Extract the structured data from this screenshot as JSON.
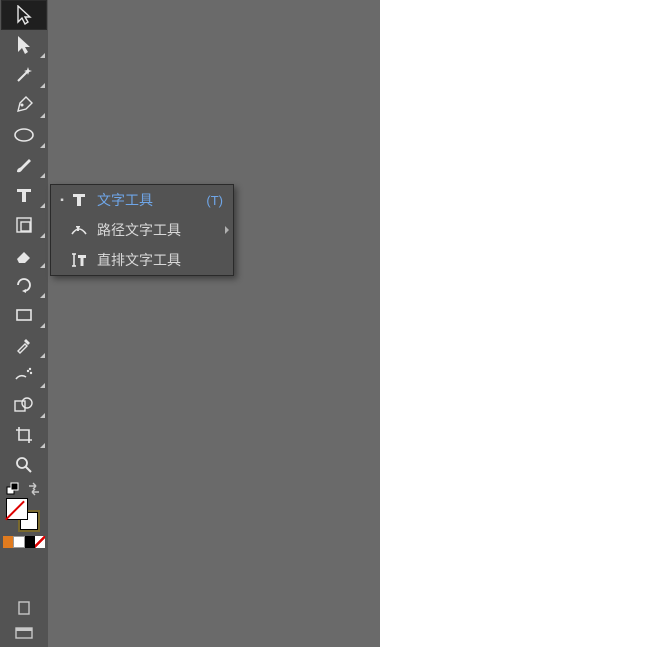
{
  "toolbar": {
    "tools": [
      {
        "name": "selection-tool",
        "selected": true,
        "flyout": false
      },
      {
        "name": "direct-selection-tool",
        "selected": false,
        "flyout": true
      },
      {
        "name": "magic-wand-tool",
        "selected": false,
        "flyout": true
      },
      {
        "name": "pen-tool",
        "selected": false,
        "flyout": true
      },
      {
        "name": "ellipse-tool",
        "selected": false,
        "flyout": true
      },
      {
        "name": "paintbrush-tool",
        "selected": false,
        "flyout": true
      },
      {
        "name": "type-tool",
        "selected": false,
        "flyout": true
      },
      {
        "name": "artboard-tool",
        "selected": false,
        "flyout": true
      },
      {
        "name": "eraser-tool",
        "selected": false,
        "flyout": true
      },
      {
        "name": "rotate-tool",
        "selected": false,
        "flyout": true
      },
      {
        "name": "rectangle-tool",
        "selected": false,
        "flyout": true
      },
      {
        "name": "eyedropper-tool",
        "selected": false,
        "flyout": true
      },
      {
        "name": "symbol-sprayer-tool",
        "selected": false,
        "flyout": true
      },
      {
        "name": "shape-builder-tool",
        "selected": false,
        "flyout": true
      },
      {
        "name": "crop-tool",
        "selected": false,
        "flyout": true
      },
      {
        "name": "zoom-tool",
        "selected": false,
        "flyout": false
      }
    ]
  },
  "flyout": {
    "items": [
      {
        "icon": "type-icon",
        "label": "文字工具",
        "shortcut": "(T)",
        "current": true,
        "submenu": false
      },
      {
        "icon": "type-on-path-icon",
        "label": "路径文字工具",
        "shortcut": "",
        "current": false,
        "submenu": true
      },
      {
        "icon": "vertical-type-icon",
        "label": "直排文字工具",
        "shortcut": "",
        "current": false,
        "submenu": false
      }
    ]
  },
  "bottom": {
    "swap_icon": "swap-fill-stroke-icon",
    "default_icon": "default-fill-stroke-icon",
    "doc_icon": "document-icon",
    "screen_icon": "screen-mode-icon"
  }
}
